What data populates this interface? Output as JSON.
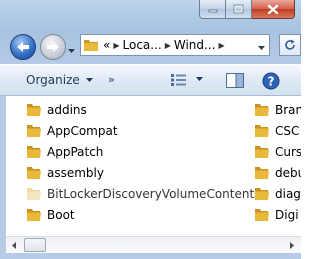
{
  "window": {
    "caption_buttons": [
      {
        "name": "minimize",
        "icon": "minimize-icon"
      },
      {
        "name": "maximize",
        "icon": "maximize-icon"
      },
      {
        "name": "close",
        "icon": "close-icon"
      }
    ]
  },
  "nav": {
    "back_icon": "back-arrow-icon",
    "forward_icon": "forward-arrow-icon",
    "address": {
      "overflow": "«",
      "crumbs": [
        "Loca...",
        "Wind..."
      ],
      "icon": "folder-icon"
    },
    "refresh_icon": "refresh-icon"
  },
  "toolbar": {
    "organize_label": "Organize",
    "more_label": "»",
    "views_icon": "views-icon",
    "preview_icon": "preview-pane-icon",
    "help_icon": "help-icon"
  },
  "files": {
    "left_column": [
      {
        "name": "addins",
        "faded": false
      },
      {
        "name": "AppCompat",
        "faded": false
      },
      {
        "name": "AppPatch",
        "faded": false
      },
      {
        "name": "assembly",
        "faded": false
      },
      {
        "name": "BitLockerDiscoveryVolumeContents",
        "faded": true
      },
      {
        "name": "Boot",
        "faded": false
      }
    ],
    "right_column": [
      {
        "name": "Bran",
        "faded": false
      },
      {
        "name": "CSC",
        "faded": false
      },
      {
        "name": "Curs",
        "faded": false
      },
      {
        "name": "debu",
        "faded": false
      },
      {
        "name": "diag",
        "faded": false
      },
      {
        "name": "Digi",
        "faded": false
      }
    ]
  },
  "colors": {
    "folder": "#e8b93a",
    "folder_dark": "#c99422",
    "accent": "#2f6bc4",
    "toolbar_text": "#1e395b",
    "close_button": "#c23a1f"
  }
}
